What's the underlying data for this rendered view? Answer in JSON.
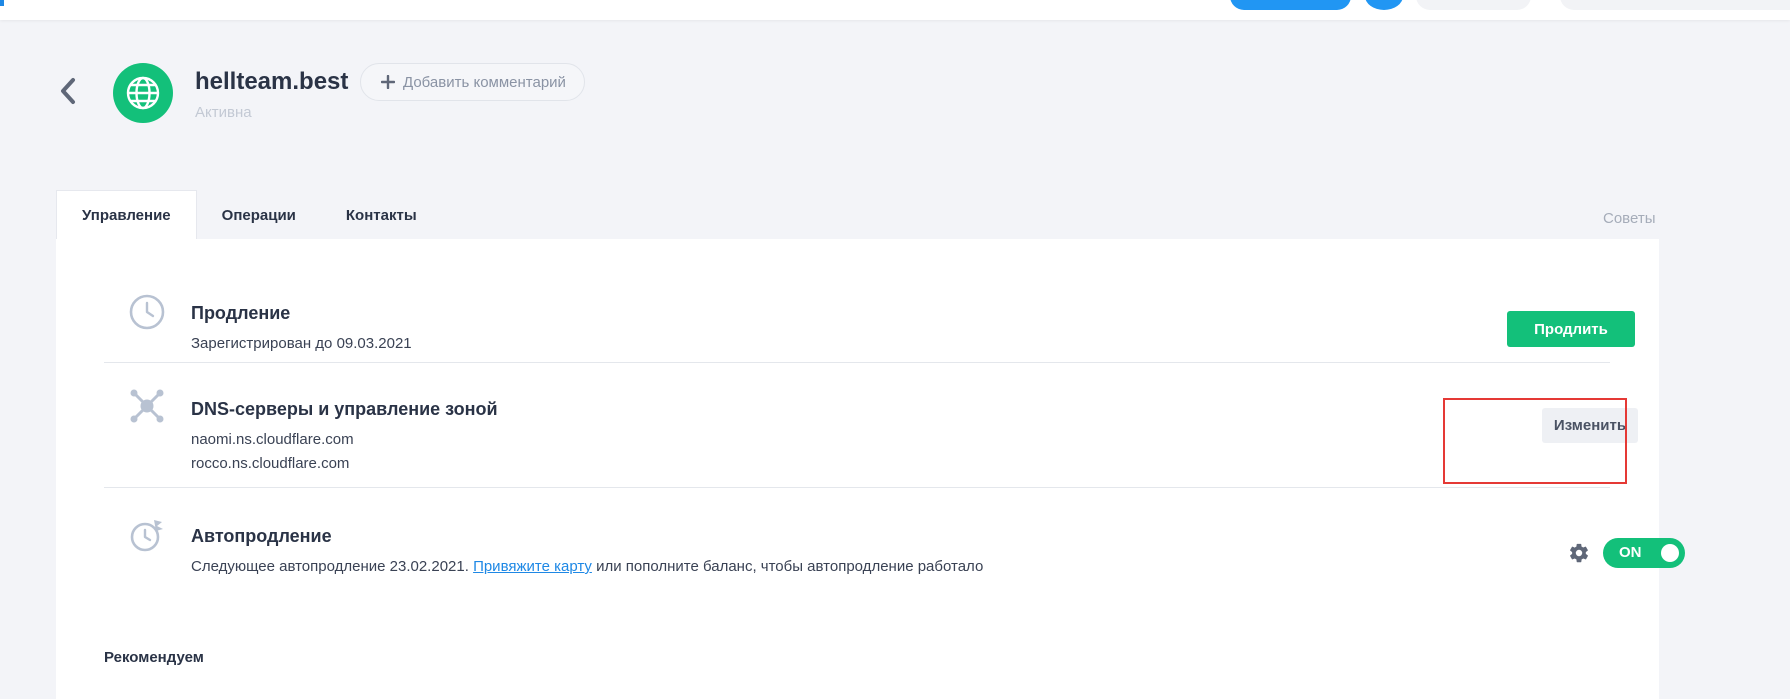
{
  "colors": {
    "accent_green": "#13c07a",
    "link_blue": "#1e88e5",
    "highlight_red": "#e53935",
    "page_background": "#f3f4f8"
  },
  "header": {
    "back_icon": "chevron-left-icon",
    "avatar_icon": "globe-icon",
    "domain": "hellteam.best",
    "status": "Активна",
    "add_comment_icon": "plus-icon",
    "add_comment_label": "Добавить комментарий"
  },
  "tabs": [
    {
      "label": "Управление",
      "active": true
    },
    {
      "label": "Операции",
      "active": false
    },
    {
      "label": "Контакты",
      "active": false
    }
  ],
  "tips_label": "Советы",
  "sections": {
    "renewal": {
      "icon": "clock-icon",
      "title": "Продление",
      "line": "Зарегистрирован до 09.03.2021",
      "button": "Продлить"
    },
    "dns": {
      "icon": "network-icon",
      "title": "DNS-серверы и управление зоной",
      "servers": [
        "naomi.ns.cloudflare.com",
        "rocco.ns.cloudflare.com"
      ],
      "button": "Изменить"
    },
    "autorenew": {
      "icon": "clock-renew-icon",
      "title": "Автопродление",
      "line_prefix": "Следующее автопродление 23.02.2021.",
      "link_text": "Привяжите карту",
      "line_suffix": "или пополните баланс, чтобы автопродление работало",
      "settings_icon": "gear-icon",
      "toggle_label": "ON",
      "toggle_on": true
    }
  },
  "recommend_label": "Рекомендуем"
}
